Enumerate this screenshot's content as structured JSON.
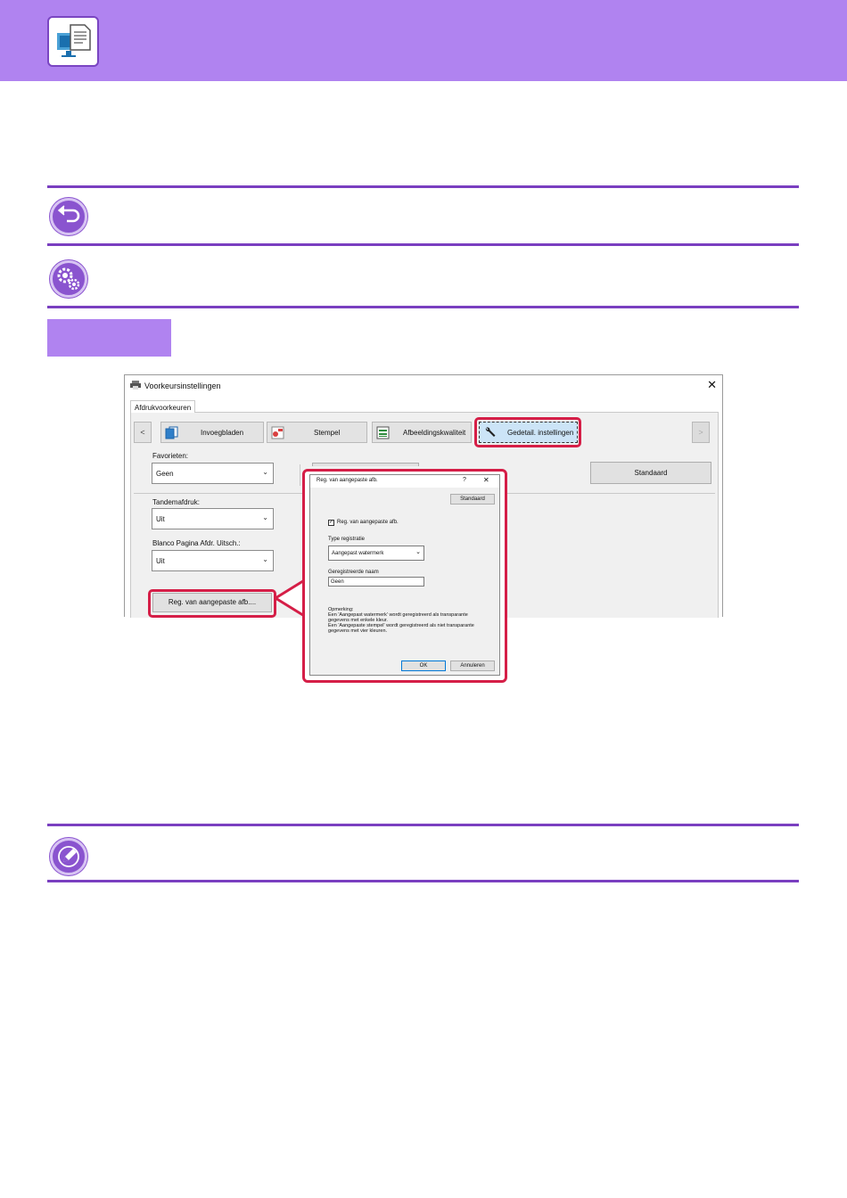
{
  "window": {
    "title": "Voorkeursinstellingen",
    "close_glyph": "✕"
  },
  "tabs": [
    {
      "label": "Afdrukvoorkeuren"
    }
  ],
  "toolbar": {
    "prev_label": "<",
    "next_label": ">",
    "items": [
      {
        "label": "Invoegbladen",
        "icon": "pages-icon"
      },
      {
        "label": "Stempel",
        "icon": "stamp-icon"
      },
      {
        "label": "Afbeeldingskwaliteit",
        "icon": "image-quality-icon"
      },
      {
        "label": "Gedetail. instellingen",
        "icon": "wrench-icon",
        "selected": true
      }
    ]
  },
  "favorites": {
    "label": "Favorieten:",
    "value": "Geen",
    "standard_button": "Standaard"
  },
  "tandem": {
    "label": "Tandemafdruk:",
    "value": "Uit"
  },
  "blank_page": {
    "label": "Blanco Pagina Afdr. Uitsch.:",
    "value": "Uit"
  },
  "register_button": "Reg. van aangepaste afb....",
  "popup": {
    "title": "Reg. van aangepaste afb.",
    "help_glyph": "?",
    "close_glyph": "✕",
    "standard_button": "Standaard",
    "checkbox_label": "Reg. van aangepaste afb.",
    "checkbox_checked": true,
    "type_label": "Type registratie",
    "type_value": "Aangepast watermerk",
    "name_label": "Geregistreerde naam",
    "name_value": "Geen",
    "note_lines": [
      "Opmerking:",
      "Een 'Aangepast watermerk' wordt geregistreerd als transparante",
      "gegevens met enkele kleur.",
      "Een 'Aangepaste stempel' wordt geregistreerd als niet transparante",
      "gegevens met vier kleuren."
    ],
    "ok_button": "OK",
    "cancel_button": "Annuleren"
  },
  "colors": {
    "header": "#b083f0",
    "rule": "#7a3fc0",
    "highlight": "#d51e47"
  }
}
